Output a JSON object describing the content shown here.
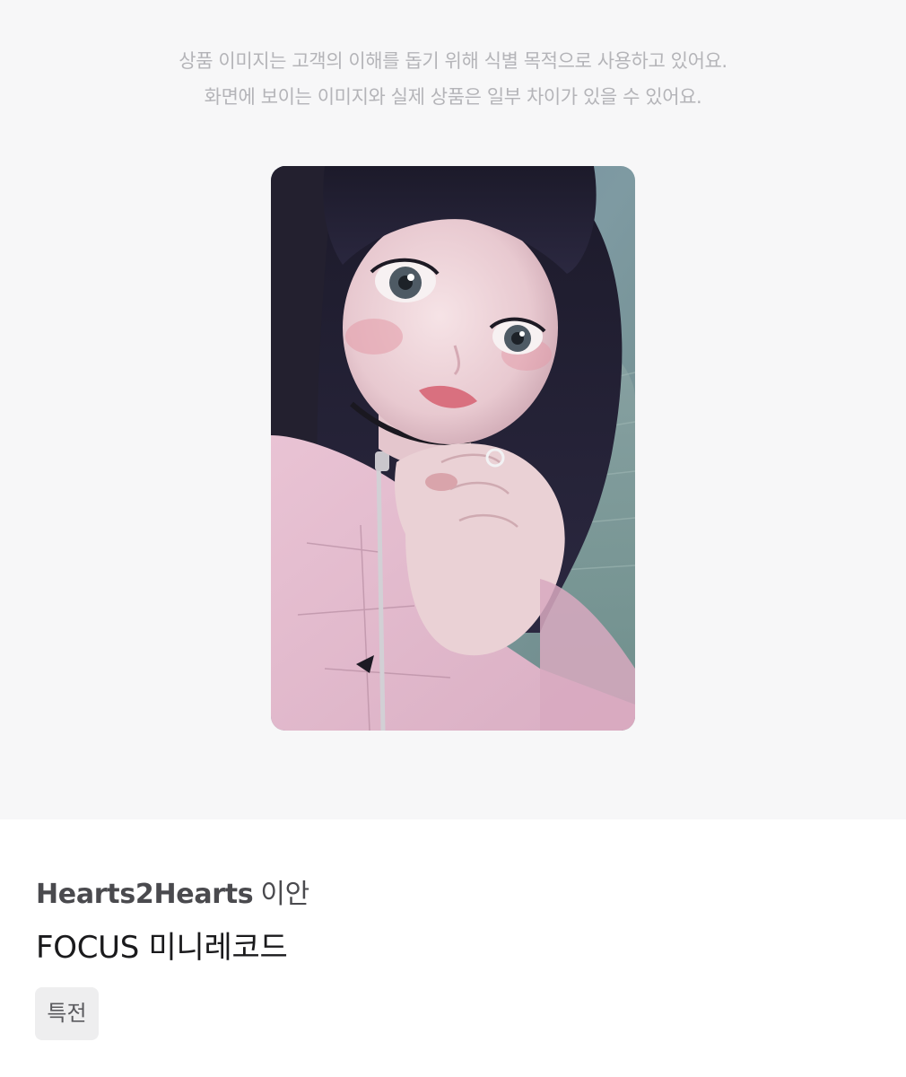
{
  "notice": {
    "line1": "상품 이미지는 고객의 이해를 돕기 위해 식별 목적으로 사용하고 있어요.",
    "line2": "화면에 보이는 이미지와 실제 상품은 일부 차이가 있을 수 있어요."
  },
  "product": {
    "artist": "Hearts2Hearts",
    "member": "이안",
    "title": "FOCUS 미니레코드",
    "tag": "특전"
  }
}
